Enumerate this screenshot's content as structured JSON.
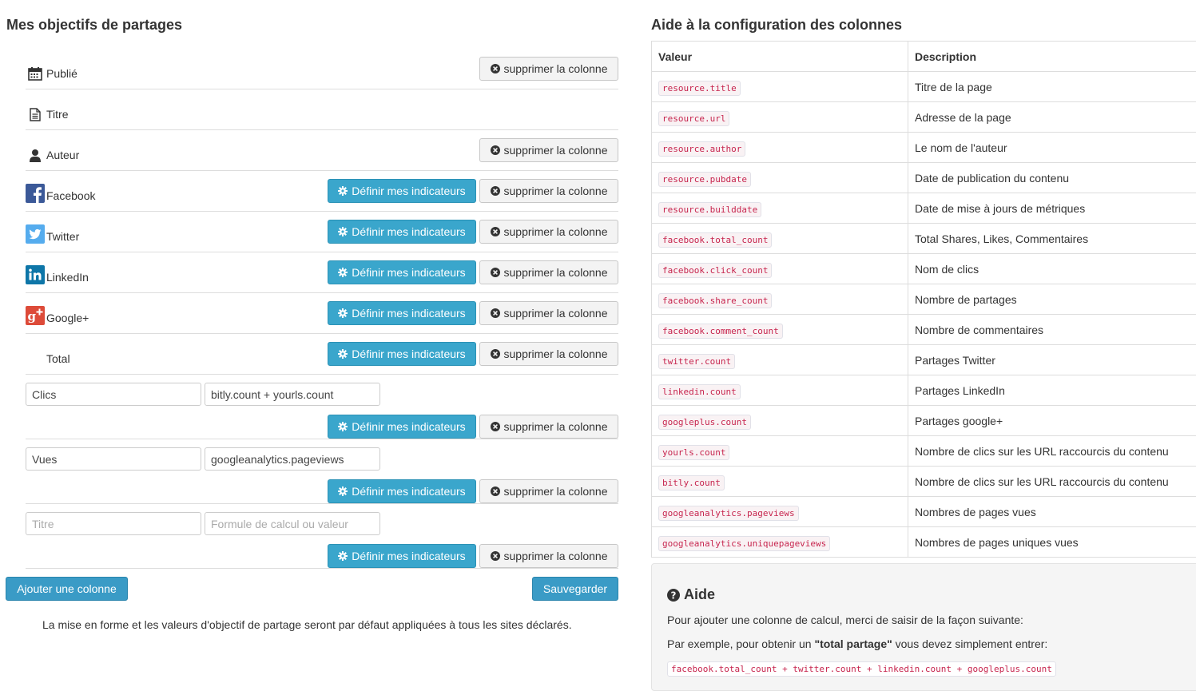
{
  "left": {
    "title": "Mes objectifs de partages",
    "rows": [
      {
        "label": "Publié",
        "icon": "calendar-icon",
        "define": false,
        "delete": true
      },
      {
        "label": "Titre",
        "icon": "file-text-icon",
        "define": false,
        "delete": false
      },
      {
        "label": "Auteur",
        "icon": "user-icon",
        "define": false,
        "delete": true
      },
      {
        "label": "Facebook",
        "icon": "facebook-icon",
        "define": true,
        "delete": true
      },
      {
        "label": "Twitter",
        "icon": "twitter-icon",
        "define": true,
        "delete": true
      },
      {
        "label": "LinkedIn",
        "icon": "linkedin-icon",
        "define": true,
        "delete": true
      },
      {
        "label": "Google+",
        "icon": "googleplus-icon",
        "define": true,
        "delete": true
      },
      {
        "label": "Total",
        "icon": "",
        "define": true,
        "delete": true
      }
    ],
    "custom_rows": [
      {
        "name_value": "Clics",
        "formula_value": "bitly.count + yourls.count"
      },
      {
        "name_value": "Vues",
        "formula_value": "googleanalytics.pageviews"
      },
      {
        "name_value": "",
        "formula_value": ""
      }
    ],
    "name_placeholder": "Titre",
    "formula_placeholder": "Formule de calcul ou valeur",
    "define_label": "Définir mes indicateurs",
    "delete_label": "supprimer la colonne",
    "add_label": "Ajouter une colonne",
    "save_label": "Sauvegarder",
    "note": "La mise en forme et les valeurs d'objectif de partage seront par défaut appliquées à tous les sites déclarés."
  },
  "right": {
    "title": "Aide à la configuration des colonnes",
    "headers": {
      "value": "Valeur",
      "description": "Description"
    },
    "rows": [
      {
        "value": "resource.title",
        "description": "Titre de la page"
      },
      {
        "value": "resource.url",
        "description": "Adresse de la page"
      },
      {
        "value": "resource.author",
        "description": "Le nom de l'auteur"
      },
      {
        "value": "resource.pubdate",
        "description": "Date de publication du contenu"
      },
      {
        "value": "resource.builddate",
        "description": "Date de mise à jours de métriques"
      },
      {
        "value": "facebook.total_count",
        "description": "Total Shares, Likes, Commentaires"
      },
      {
        "value": "facebook.click_count",
        "description": "Nom de clics"
      },
      {
        "value": "facebook.share_count",
        "description": "Nombre de partages"
      },
      {
        "value": "facebook.comment_count",
        "description": "Nombre de commentaires"
      },
      {
        "value": "twitter.count",
        "description": "Partages Twitter"
      },
      {
        "value": "linkedin.count",
        "description": "Partages LinkedIn"
      },
      {
        "value": "googleplus.count",
        "description": "Partages google+"
      },
      {
        "value": "yourls.count",
        "description": "Nombre de clics sur les URL raccourcis du contenu"
      },
      {
        "value": "bitly.count",
        "description": "Nombre de clics sur les URL raccourcis du contenu"
      },
      {
        "value": "googleanalytics.pageviews",
        "description": "Nombres de pages vues"
      },
      {
        "value": "googleanalytics.uniquepageviews",
        "description": "Nombres de pages uniques vues"
      }
    ],
    "help": {
      "title": "Aide",
      "line1": "Pour ajouter une colonne de calcul, merci de saisir de la façon suivante:",
      "line2_pre": "Par exemple, pour obtenir un ",
      "line2_bold": "\"total partage\"",
      "line2_post": " vous devez simplement entrer:",
      "example": "facebook.total_count + twitter.count + linkedin.count + googleplus.count"
    }
  },
  "colors": {
    "info": "#3aa6cc",
    "primary": "#3a9bc6",
    "code_text": "#c7254e",
    "facebook": "#3b5998",
    "twitter": "#55acee",
    "linkedin": "#0e76a8",
    "googleplus": "#dd4b39"
  }
}
